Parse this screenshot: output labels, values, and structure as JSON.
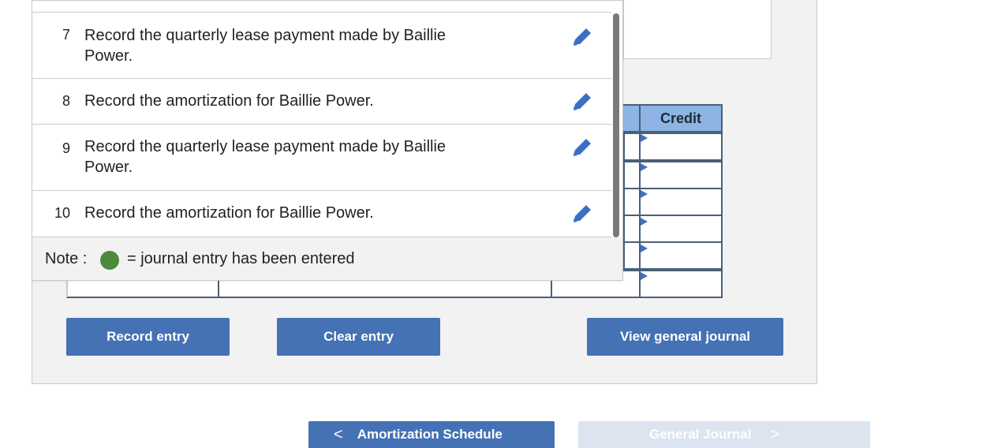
{
  "entries": [
    {
      "num": "7",
      "line1": "Record the quarterly lease payment made by Baillie",
      "line2": "Power."
    },
    {
      "num": "8",
      "line1": "Record the amortization for Baillie Power.",
      "line2": ""
    },
    {
      "num": "9",
      "line1": "Record the quarterly lease payment made by Baillie",
      "line2": "Power."
    },
    {
      "num": "10",
      "line1": "Record the amortization for Baillie Power.",
      "line2": ""
    }
  ],
  "note": {
    "label": "Note :",
    "text": "= journal entry has been entered",
    "dot_color": "#4f8a3c"
  },
  "journal": {
    "credit_header": "Credit"
  },
  "buttons": {
    "record": "Record entry",
    "clear": "Clear entry",
    "view": "View general journal"
  },
  "nav": {
    "prev_chevron": "<",
    "prev": "Amortization Schedule",
    "next": "General Journal",
    "next_chevron": ">"
  },
  "colors": {
    "accent": "#4472b4",
    "header_blue": "#8db4e2",
    "pencil": "#3b6fc4"
  }
}
